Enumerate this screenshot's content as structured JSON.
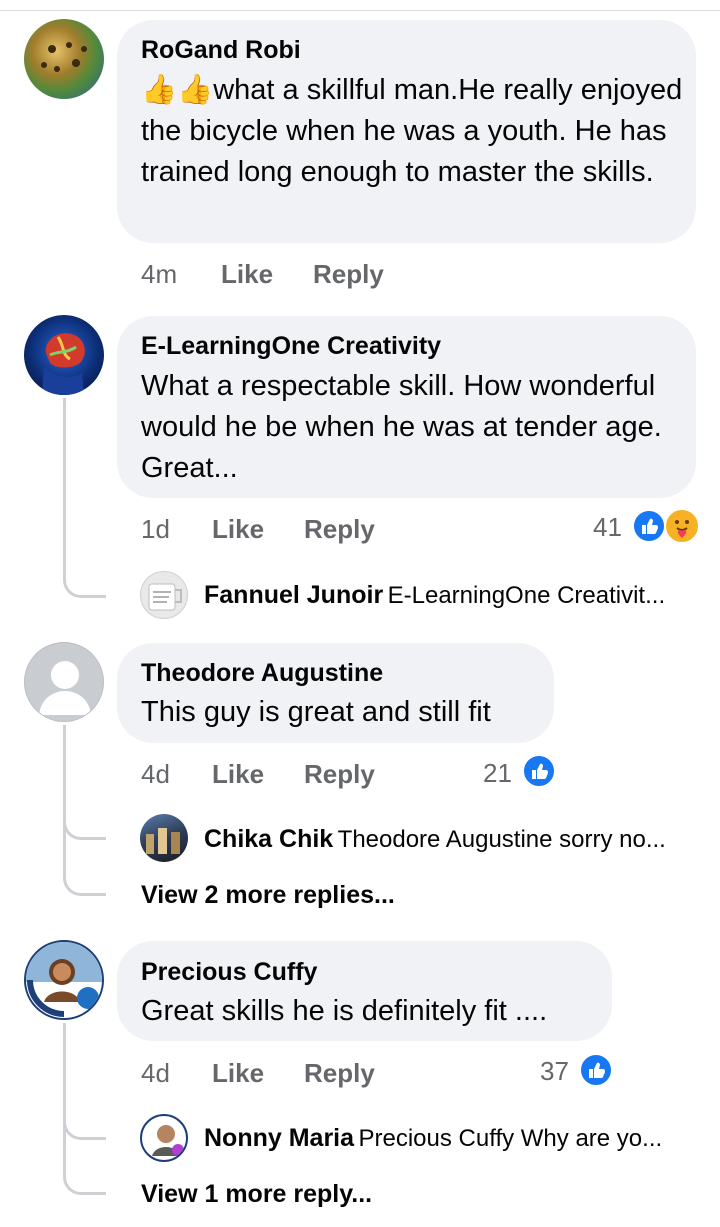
{
  "comments": [
    {
      "author": "RoGand Robi",
      "emoji": "👍👍",
      "text": "what a skillful man.He really enjoyed the bicycle when he was a youth. He has trained long enough to master the skills.",
      "time": "4m",
      "like": "Like",
      "reply": "Reply"
    },
    {
      "author": "E-LearningOne Creativity",
      "text": "What a respectable skill. How wonderful would he be when he was at tender age. Great...",
      "time": "1d",
      "like": "Like",
      "reply": "Reply",
      "reactions": "41",
      "reply_preview": {
        "author": "Fannuel Junoir",
        "text": "E-LearningOne Creativit..."
      }
    },
    {
      "author": "Theodore Augustine",
      "text": "This guy is great and still fit",
      "time": "4d",
      "like": "Like",
      "reply": "Reply",
      "reactions": "21",
      "reply_preview": {
        "author": "Chika Chik",
        "text": "Theodore Augustine sorry no..."
      },
      "more_replies": "View 2 more replies..."
    },
    {
      "author": "Precious Cuffy",
      "text": "Great skills he is definitely fit ....",
      "time": "4d",
      "like": "Like",
      "reply": "Reply",
      "reactions": "37",
      "reply_preview": {
        "author": "Nonny Maria",
        "text": "Precious Cuffy Why are yo..."
      },
      "more_replies": "View 1 more reply..."
    }
  ],
  "colors": {
    "bubble": "#f0f2f5",
    "meta": "#65676b",
    "like_blue": "#1877f2",
    "thread": "#ced0d4"
  },
  "icons": {
    "like": "thumbs-up-icon",
    "care": "care-reaction-icon"
  }
}
